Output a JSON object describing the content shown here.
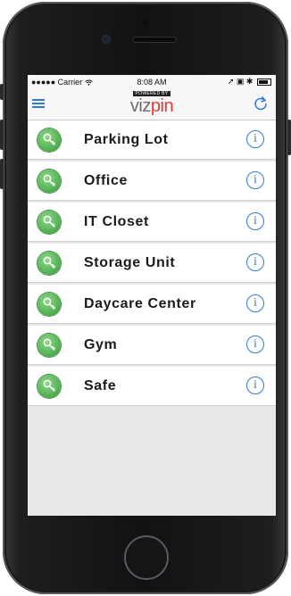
{
  "status_bar": {
    "carrier": "●●●●● Carrier",
    "wifi_icon": "wifi-icon",
    "time": "8:08 AM",
    "right_icons": "➚ ▣ ✱"
  },
  "nav": {
    "menu_icon": "hamburger-menu-icon",
    "powered_by": "POWERED BY",
    "brand_part1": "viz",
    "brand_part2": "pin",
    "refresh_icon": "refresh-icon",
    "brand_color": "#e53935"
  },
  "doors": [
    {
      "label": "Parking Lot",
      "info": "i"
    },
    {
      "label": "Office",
      "info": "i"
    },
    {
      "label": "IT Closet",
      "info": "i"
    },
    {
      "label": "Storage Unit",
      "info": "i"
    },
    {
      "label": "Daycare Center",
      "info": "i"
    },
    {
      "label": "Gym",
      "info": "i"
    },
    {
      "label": "Safe",
      "info": "i"
    }
  ],
  "colors": {
    "key_green": "#5ab75a",
    "info_blue": "#2f7ad6"
  }
}
